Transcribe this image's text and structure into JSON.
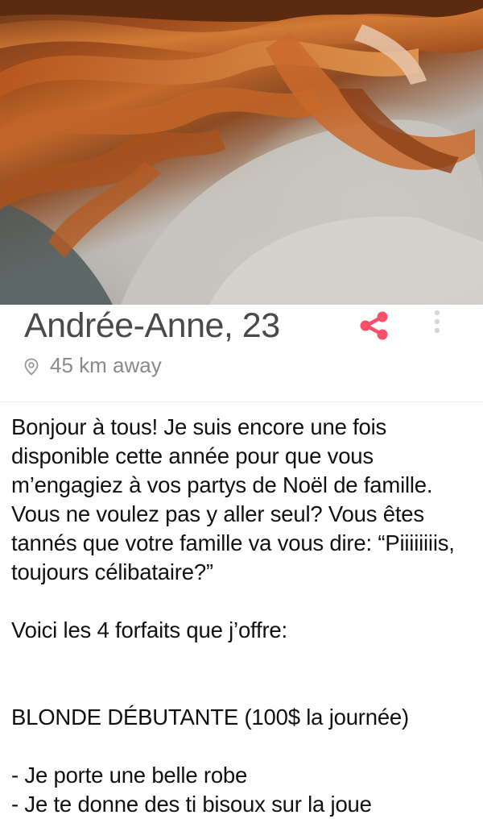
{
  "profile": {
    "name_age": "Andrée-Anne, 23",
    "distance": "45 km away",
    "bio": "Bonjour à tous! Je suis encore une fois disponible cette année pour que vous m’engagiez à vos partys de Noël de famille. Vous ne voulez pas y aller seul? Vous êtes tannés que votre famille va vous dire: “Piiiiiiiis, toujours célibataire?”\n\nVoici les 4 forfaits que j’offre:\n\n\nBLONDE DÉBUTANTE (100$ la journée)\n\n- Je porte une belle robe\n- Je te donne des ti bisoux sur la joue"
  },
  "icons": {
    "share": "share-icon",
    "more": "more-vertical-icon",
    "location": "location-pin-icon"
  },
  "colors": {
    "accent": "#fd4f68",
    "text_primary": "#4a4a4a",
    "text_secondary": "#8a8a8a"
  }
}
